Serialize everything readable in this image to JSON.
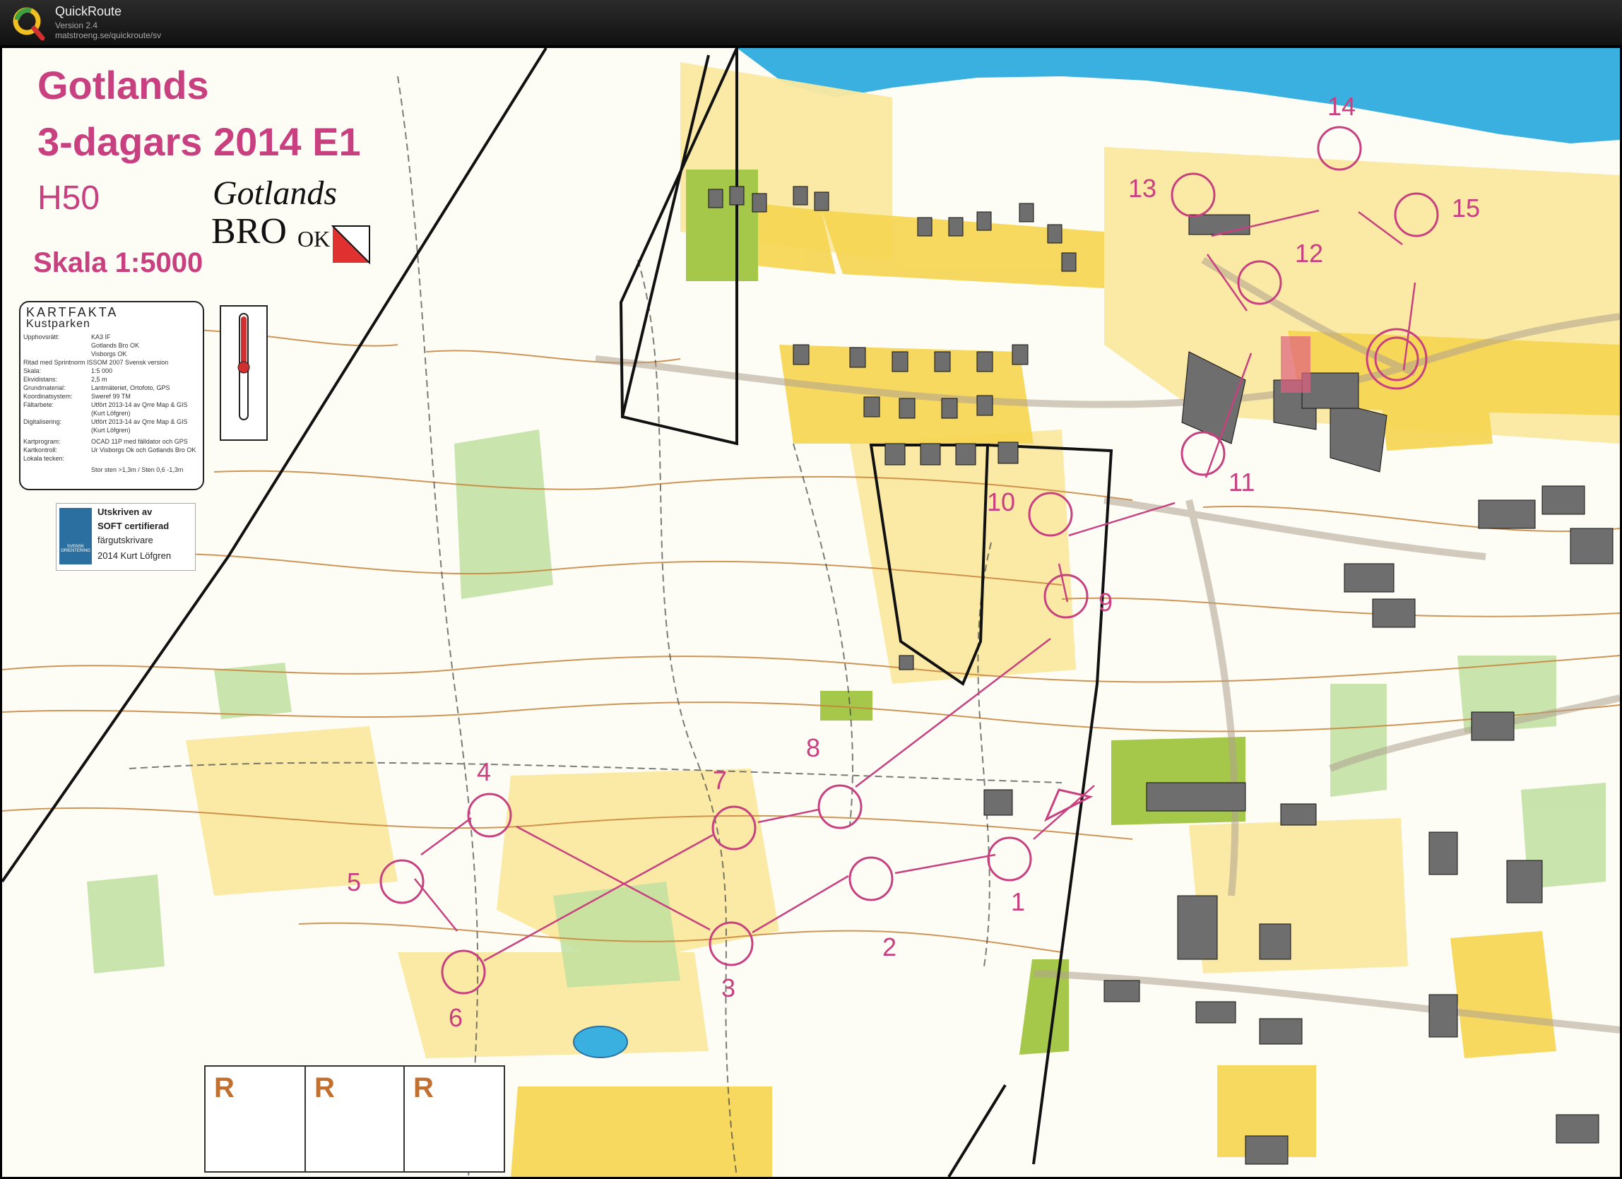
{
  "app": {
    "title": "QuickRoute",
    "version": "Version 2.4",
    "url": "matstroeng.se/quickroute/sv"
  },
  "map": {
    "event_line1": "Gotlands",
    "event_line2": "3-dagars 2014 E1",
    "class": "H50",
    "scale": "Skala 1:5000",
    "club_logo": {
      "line1": "Gotlands",
      "line2": "BRO",
      "line3": "OK"
    },
    "kartfakta": {
      "title": "KARTFAKTA",
      "subtitle": "Kustparken",
      "rows": [
        {
          "label": "Upphovsrätt:",
          "value": "KA3 IF"
        },
        {
          "label": "",
          "value": "Gotlands Bro OK"
        },
        {
          "label": "",
          "value": "Visborgs OK"
        },
        {
          "label": "Ritad med Sprintnorm ISSOM 2007 Svensk version",
          "value": ""
        },
        {
          "label": "Skala:",
          "value": "1:5 000"
        },
        {
          "label": "Ekvidistans:",
          "value": "2,5 m"
        },
        {
          "label": "Grundmaterial:",
          "value": "Lantmäteriet, Ortofoto, GPS"
        },
        {
          "label": "Koordinatsystem:",
          "value": "Sweref 99 TM"
        },
        {
          "label": "Fältarbete:",
          "value": "Utfört 2013-14 av Qrre Map & GIS"
        },
        {
          "label": "",
          "value": "(Kurt Löfgren)"
        },
        {
          "label": "Digitalisering:",
          "value": "Utfört 2013-14 av Qrre Map & GIS"
        },
        {
          "label": "",
          "value": "(Kurt Löfgren)"
        },
        {
          "label": "Kartprogram:",
          "value": "OCAD 11P med fälldator och GPS"
        },
        {
          "label": "Kartkontroll:",
          "value": "Ur Visborgs Ok och Gotlands Bro OK"
        },
        {
          "label": "Lokala tecken:",
          "value": ""
        },
        {
          "label": "",
          "value": "Stor sten >1,3m / Sten 0,6 -1,3m"
        }
      ]
    },
    "soft_notice": {
      "badge": "SVENSK ORIENTERING",
      "line1": "Utskriven av",
      "line2": "SOFT certifierad",
      "line3": "färgutskrivare",
      "line4": "2014  Kurt Löfgren"
    },
    "restricted_boxes": [
      "R",
      "R",
      "R"
    ],
    "course": {
      "color": "#c8407f",
      "controls": [
        {
          "id": 1,
          "label": "1"
        },
        {
          "id": 2,
          "label": "2"
        },
        {
          "id": 3,
          "label": "3"
        },
        {
          "id": 4,
          "label": "4"
        },
        {
          "id": 5,
          "label": "5"
        },
        {
          "id": 6,
          "label": "6"
        },
        {
          "id": 7,
          "label": "7"
        },
        {
          "id": 8,
          "label": "8"
        },
        {
          "id": 9,
          "label": "9"
        },
        {
          "id": 10,
          "label": "10"
        },
        {
          "id": 11,
          "label": "11"
        },
        {
          "id": 12,
          "label": "12"
        },
        {
          "id": 13,
          "label": "13"
        },
        {
          "id": 14,
          "label": "14"
        },
        {
          "id": 15,
          "label": "15"
        }
      ]
    }
  }
}
